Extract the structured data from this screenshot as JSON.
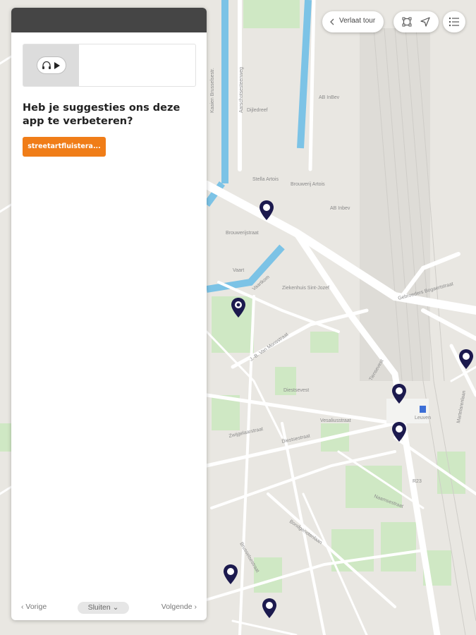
{
  "panel": {
    "question": "Heb je suggesties ons deze app te verbeteren?",
    "link_label": "streetartfluistera...",
    "footer": {
      "prev_label": "‹  Vorige",
      "close_label": "Sluiten ⌄",
      "next_label": "Volgende  ›"
    }
  },
  "map_controls": {
    "leave_tour_label": "Verlaat tour"
  },
  "map_labels": {
    "kbr": "Kaaien Brusselsestr.",
    "aarschot": "Aarschotsesteenweg",
    "dijle": "Dijledreef",
    "ab_inbev": "AB InBev",
    "stella": "Stella Artois",
    "brouwerij": "Brouwerij Artois",
    "ab_inbev2": "AB Inbev",
    "brouwerij_str": "Brouwerijstraat",
    "vaart": "Vaart",
    "vaartkom": "Vaartkom",
    "hospital": "Ziekenhuis Sint-Jozef",
    "jb_van_monsstraat": "J.-B. Van Monsstraat",
    "diestsevest": "Diestsevest",
    "zwijgelaar": "Zwijgelaarstraat",
    "vesalius": "Vesaliusstraat",
    "station": "Leuven",
    "diestsesteenweg": "Diestsestraat",
    "tiensesteenweg": "Tiensevest",
    "bondgenotenlaan": "Bondgenotenlaan",
    "brusselsestr": "Brusselsestraat",
    "naamsestraat": "Naamsestraat",
    "vest": "Gebroeders Bogaertstraat",
    "kessel_lo": "Martelarenlaan",
    "r23": "R23"
  }
}
